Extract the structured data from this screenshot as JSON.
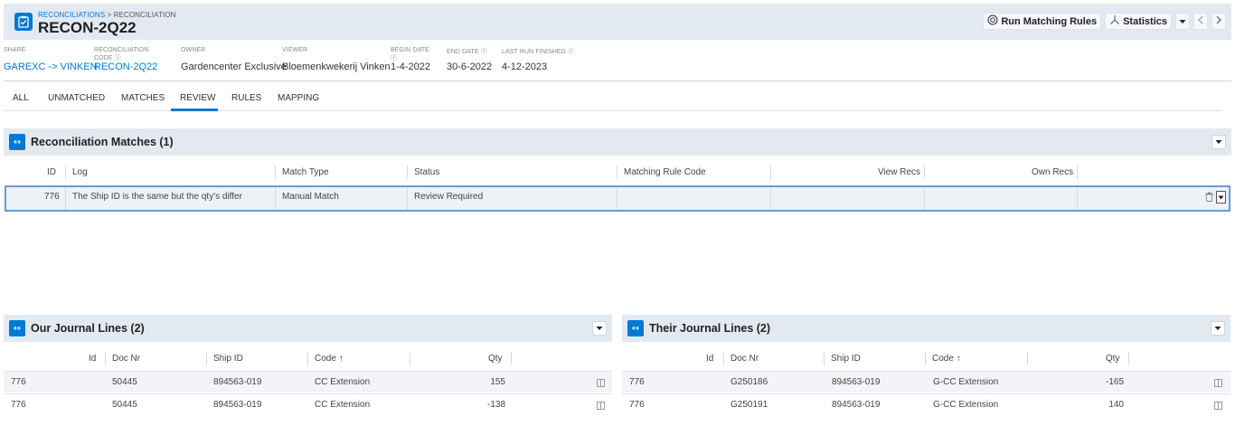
{
  "header": {
    "breadcrumb_parent": "RECONCILIATIONS",
    "breadcrumb_sep": " > ",
    "breadcrumb_current": "RECONCILIATION",
    "title": "RECON-2Q22",
    "run_matching_rules": "Run Matching Rules",
    "statistics": "Statistics"
  },
  "meta": [
    {
      "label": "SHARE",
      "value": "GAREXC -> VINKEN",
      "link": true
    },
    {
      "label": "RECONCILIATION CODE",
      "value": "RECON-2Q22",
      "link": true
    },
    {
      "label": "OWNER",
      "value": "Gardencenter Exclusive",
      "link": false
    },
    {
      "label": "VIEWER",
      "value": "Bloemenkwekerij Vinken",
      "link": false
    },
    {
      "label": "BEGIN DATE",
      "value": "1-4-2022",
      "link": false
    },
    {
      "label": "END DATE",
      "value": "30-6-2022",
      "link": false
    },
    {
      "label": "LAST RUN FINISHED",
      "value": "4-12-2023",
      "link": false
    }
  ],
  "tabs": [
    "ALL",
    "UNMATCHED",
    "MATCHES",
    "REVIEW",
    "RULES",
    "MAPPING"
  ],
  "active_tab": "REVIEW",
  "matches_panel": {
    "title": "Reconciliation Matches (1)",
    "columns": [
      "ID",
      "Log",
      "Match Type",
      "Status",
      "Matching Rule Code",
      "View Recs",
      "Own Recs"
    ],
    "rows": [
      {
        "id": "776",
        "log": "The Ship ID is the same but the qty's differ",
        "match_type": "Manual Match",
        "status": "Review Required",
        "rule_code": "",
        "view_recs": "",
        "own_recs": ""
      }
    ]
  },
  "our_panel": {
    "title": "Our Journal Lines (2)",
    "columns": [
      "Id",
      "Doc Nr",
      "Ship ID",
      "Code ↑",
      "Qty"
    ],
    "rows": [
      {
        "id": "776",
        "doc": "50445",
        "ship": "894563-019",
        "code": "CC Extension",
        "qty": "155"
      },
      {
        "id": "776",
        "doc": "50445",
        "ship": "894563-019",
        "code": "CC Extension",
        "qty": "-138"
      }
    ]
  },
  "their_panel": {
    "title": "Their Journal Lines (2)",
    "columns": [
      "Id",
      "Doc Nr",
      "Ship ID",
      "Code ↑",
      "Qty"
    ],
    "rows": [
      {
        "id": "776",
        "doc": "G250186",
        "ship": "894563-019",
        "code": "G-CC Extension",
        "qty": "-165"
      },
      {
        "id": "776",
        "doc": "G250191",
        "ship": "894563-019",
        "code": "G-CC Extension",
        "qty": "140"
      }
    ]
  },
  "colors": {
    "accent": "#0078d4",
    "panel_bg": "#e3e9f1",
    "row_bg": "#f2f4f7"
  }
}
